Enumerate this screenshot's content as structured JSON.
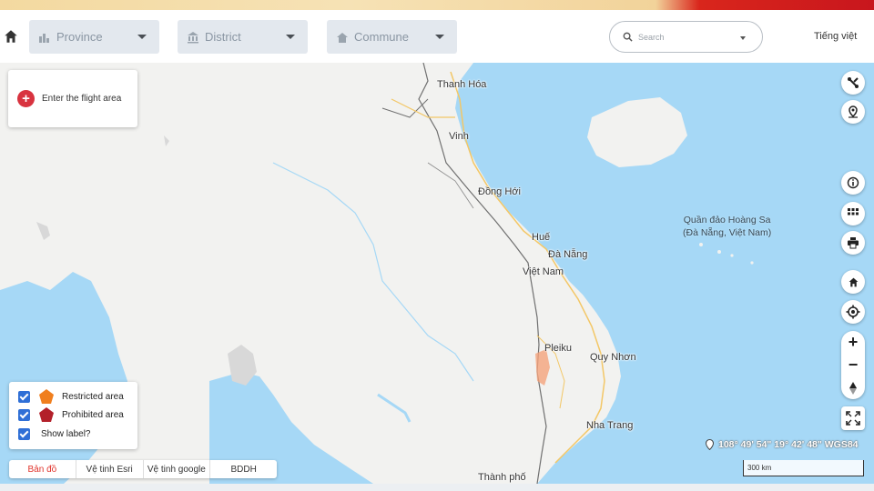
{
  "toolbar": {
    "home_icon": "home-icon",
    "province": {
      "label": "Province",
      "icon": "chart-icon"
    },
    "district": {
      "label": "District",
      "icon": "bank-icon"
    },
    "commune": {
      "label": "Commune",
      "icon": "house-icon"
    },
    "search_placeholder": "Search",
    "language": "Tiếng việt"
  },
  "flight_area": {
    "label": "Enter the flight area"
  },
  "places": {
    "thanh_hoa": "Thanh Hóa",
    "vinh": "Vinh",
    "dong_hoi": "Đồng Hới",
    "hue": "Huế",
    "da_nang": "Đà Nẵng",
    "viet_nam": "Việt Nam",
    "pleiku": "Pleiku",
    "quy_nhon": "Quy Nhơn",
    "nha_trang": "Nha Trang",
    "thanh_pho": "Thành phố",
    "hoang_sa_line1": "Quần đảo Hoàng Sa",
    "hoang_sa_line2": "(Đà Nẵng, Việt Nam)"
  },
  "legend": {
    "restricted": "Restricted area",
    "prohibited": "Prohibited area",
    "show_label": "Show label?",
    "restricted_color": "#f07f1e",
    "prohibited_color": "#b3202a"
  },
  "basemaps": [
    "Bản đồ",
    "Vệ tinh Esri",
    "Vệ tinh google",
    "BDDH"
  ],
  "coordinates": "108° 49' 54\" 19° 42' 48\" WGS84",
  "scale": "300 km",
  "colors": {
    "sea": "#a6d8f6",
    "land": "#f2f2f0",
    "accent": "#d8333f"
  }
}
